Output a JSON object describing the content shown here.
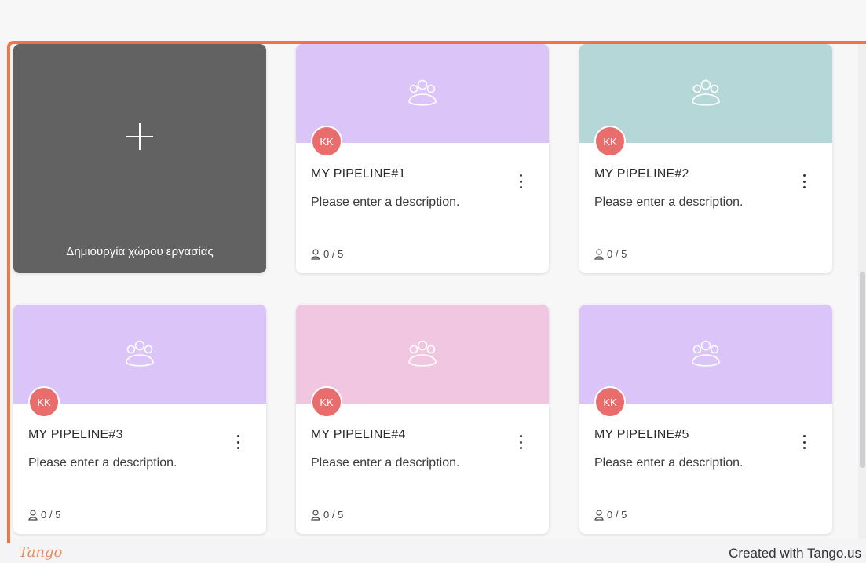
{
  "create_card": {
    "label": "Δημιουργία χώρου εργασίας"
  },
  "cards": [
    {
      "title": "MY PIPELINE#1",
      "description": "Please enter a description.",
      "avatar": "KK",
      "members": "0 / 5",
      "color": "#dac4f8"
    },
    {
      "title": "MY PIPELINE#2",
      "description": "Please enter a description.",
      "avatar": "KK",
      "members": "0 / 5",
      "color": "#b6d7d8"
    },
    {
      "title": "MY PIPELINE#3",
      "description": "Please enter a description.",
      "avatar": "KK",
      "members": "0 / 5",
      "color": "#dac4f8"
    },
    {
      "title": "MY PIPELINE#4",
      "description": "Please enter a description.",
      "avatar": "KK",
      "members": "0 / 5",
      "color": "#f1c6e0"
    },
    {
      "title": "MY PIPELINE#5",
      "description": "Please enter a description.",
      "avatar": "KK",
      "members": "0 / 5",
      "color": "#dac4f8"
    }
  ],
  "footer": {
    "logo": "Tango",
    "credit": "Created with Tango.us"
  },
  "colors": {
    "highlight_border": "#f07545",
    "avatar": "#ea6d6d",
    "create_card": "#626262"
  }
}
